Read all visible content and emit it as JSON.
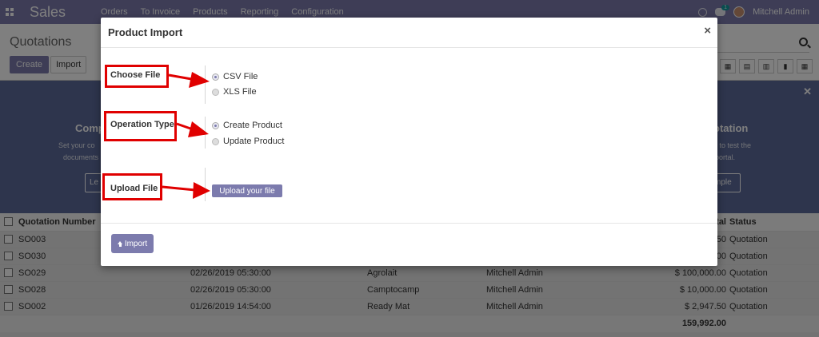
{
  "app": {
    "title": "Sales",
    "menu": [
      "Orders",
      "To Invoice",
      "Products",
      "Reporting",
      "Configuration"
    ],
    "chat_count": "1",
    "user": "Mitchell Admin"
  },
  "control_panel": {
    "breadcrumb": "Quotations",
    "create_label": "Create",
    "import_label": "Import"
  },
  "helper": {
    "left_title": "Comp",
    "left_line1": "Set your co",
    "left_line2": "documents",
    "left_button": "Le",
    "right_title": "otation",
    "right_line1": "n to test the",
    "right_line2": "portal.",
    "right_button": "mple"
  },
  "table": {
    "headers": {
      "number": "Quotation Number",
      "total": "tal",
      "status": "Status"
    },
    "rows": [
      {
        "number": "SO003",
        "date": "",
        "customer": "",
        "salesperson": "",
        "total": "50",
        "status": "Quotation"
      },
      {
        "number": "SO030",
        "date": "",
        "customer": "",
        "salesperson": "",
        "total": "00",
        "status": "Quotation"
      },
      {
        "number": "SO029",
        "date": "02/26/2019 05:30:00",
        "customer": "Agrolait",
        "salesperson": "Mitchell Admin",
        "total": "$ 100,000.00",
        "status": "Quotation"
      },
      {
        "number": "SO028",
        "date": "02/26/2019 05:30:00",
        "customer": "Camptocamp",
        "salesperson": "Mitchell Admin",
        "total": "$ 10,000.00",
        "status": "Quotation"
      },
      {
        "number": "SO002",
        "date": "01/26/2019 14:54:00",
        "customer": "Ready Mat",
        "salesperson": "Mitchell Admin",
        "total": "$ 2,947.50",
        "status": "Quotation"
      }
    ],
    "footer_total": "159,992.00"
  },
  "dialog": {
    "title": "Product Import",
    "close_symbol": "×",
    "choose_file_label": "Choose File",
    "file_options": [
      "CSV File",
      "XLS File"
    ],
    "file_selected": "CSV File",
    "operation_type_label": "Operation Type",
    "operation_options": [
      "Create Product",
      "Update Product"
    ],
    "operation_selected": "Create Product",
    "upload_file_label": "Upload File",
    "upload_button": "Upload your file",
    "import_button": "Import"
  },
  "colors": {
    "brand": "#7c7bad",
    "annotation": "#e00000"
  }
}
